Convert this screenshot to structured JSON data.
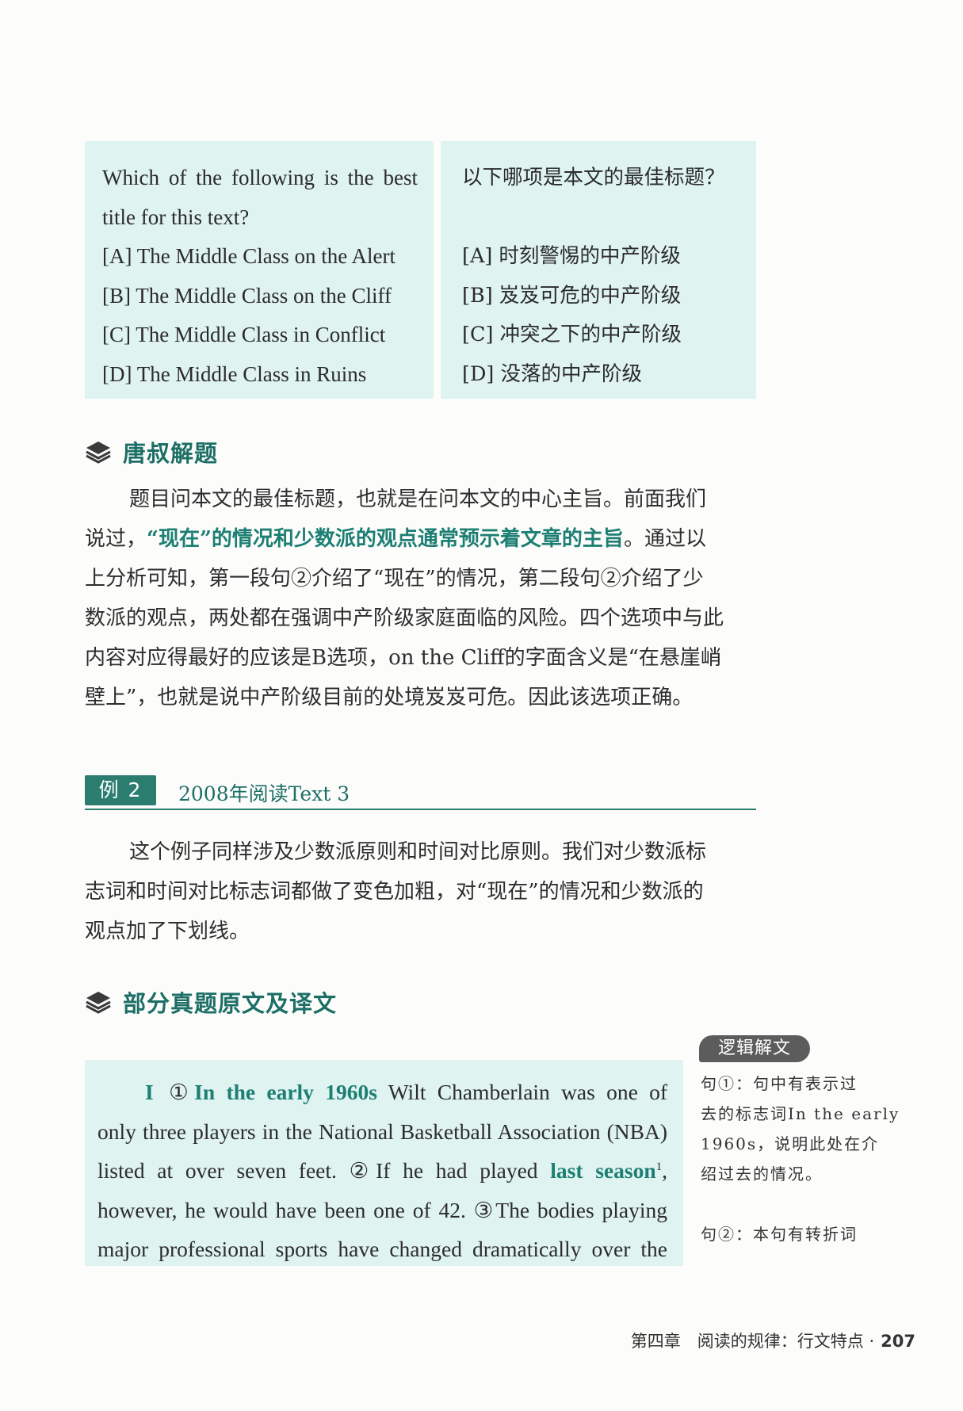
{
  "question": {
    "en_lines": [
      "Which of the following is the best",
      "title for this text?",
      "[A] The Middle Class on the Alert",
      "[B] The Middle Class on the Cliff",
      "[C] The Middle Class in Conflict",
      "[D] The Middle Class in Ruins"
    ],
    "zh_lines": [
      "以下哪项是本文的最佳标题？",
      "",
      "[A] 时刻警惕的中产阶级",
      "[B] 岌岌可危的中产阶级",
      "[C] 冲突之下的中产阶级",
      "[D] 没落的中产阶级"
    ]
  },
  "section1": {
    "title": "唐叔解题",
    "icon": "layers-icon",
    "lines": [
      {
        "pre": "题目问本文的最佳标题，也就是在问本文的中心主旨。前面我们",
        "hl": "",
        "post": ""
      },
      {
        "pre": "说过，",
        "hl": "“现在”的情况和少数派的观点通常预示着文章的主旨",
        "post": "。通过以"
      },
      {
        "pre": "上分析可知，第一段句②介绍了“现在”的情况，第二段句②介绍了少",
        "hl": "",
        "post": ""
      },
      {
        "pre": "数派的观点，两处都在强调中产阶级家庭面临的风险。四个选项中与此",
        "hl": "",
        "post": ""
      },
      {
        "pre": "内容对应得最好的应该是B选项，on the Cliff的字面含义是“在悬崖峭",
        "hl": "",
        "post": ""
      },
      {
        "pre": "壁上”，也就是说中产阶级目前的处境岌岌可危。因此该选项正确。",
        "hl": "",
        "post": ""
      }
    ]
  },
  "example": {
    "label": "例 2",
    "title": "2008年阅读Text 3",
    "lines": [
      "这个例子同样涉及少数派原则和时间对比原则。我们对少数派标",
      "志词和时间对比标志词都做了变色加粗，对“现在”的情况和少数派的",
      "观点加了下划线。"
    ]
  },
  "section2": {
    "title": "部分真题原文及译文",
    "icon": "layers-icon"
  },
  "passage": {
    "roman": "I",
    "l1": {
      "num": "①",
      "bold": "In the early 1960s",
      "rest": " Wilt Chamberlain was one of"
    },
    "l2": "only three players in the National Basketball Association (NBA)",
    "l3": {
      "pre": "listed at over seven feet. ②If he had played ",
      "bold": "last season",
      "sup": "1",
      "post": ","
    },
    "l4": "however, he would have been one of 42. ③The bodies playing",
    "l5": "major professional sports have changed dramatically over the"
  },
  "side_notes": {
    "badge": "逻辑解文",
    "note1": [
      "句①：句中有表示过",
      "去的标志词In the early",
      "1960s，说明此处在介",
      "绍过去的情况。"
    ],
    "note2": [
      "句②：本句有转折词"
    ]
  },
  "footer": {
    "chapter": "第四章　阅读的规律：行文特点 ·",
    "page": "207"
  }
}
